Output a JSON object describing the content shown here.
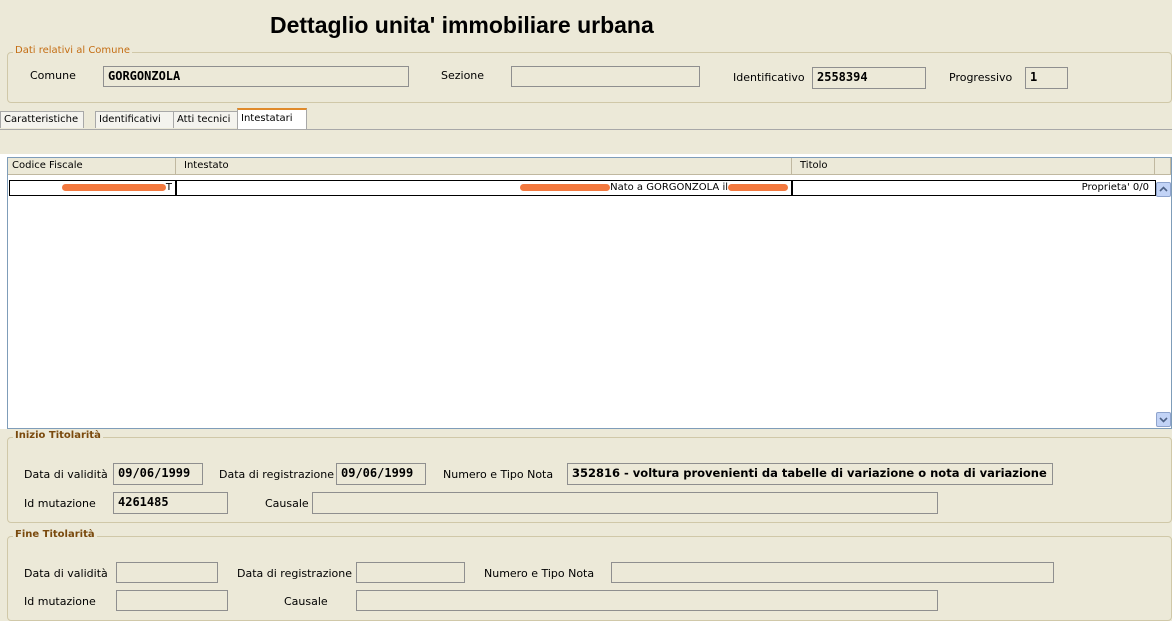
{
  "window_title": "Dettaglio unita' immobiliare urbana",
  "comune_group": {
    "legend": "Dati relativi al Comune",
    "comune_label": "Comune",
    "comune_value": "GORGONZOLA",
    "sezione_label": "Sezione",
    "sezione_value": "",
    "identificativo_label": "Identificativo",
    "identificativo_value": "2558394",
    "progressivo_label": "Progressivo",
    "progressivo_value": "1"
  },
  "tabs": [
    {
      "label": "Caratteristiche"
    },
    {
      "label": "Identificativi"
    },
    {
      "label": "Atti tecnici"
    },
    {
      "label": "Intestatari",
      "active": true
    }
  ],
  "table": {
    "headers": [
      "Codice Fiscale",
      "Intestato",
      "Titolo"
    ],
    "rows": [
      {
        "codice_fiscale": "T",
        "intestato": "Nato a GORGONZOLA il",
        "titolo": "Proprieta' 0/0"
      }
    ]
  },
  "inizio": {
    "legend": "Inizio Titolarità",
    "data_validita_label": "Data di validità",
    "data_validita_value": "09/06/1999",
    "data_registrazione_label": "Data di registrazione",
    "data_registrazione_value": "09/06/1999",
    "numero_nota_label": "Numero e Tipo Nota",
    "numero_nota_value": "352816 - voltura provenienti da tabelle di variazione o nota di variazione",
    "id_mutazione_label": "Id mutazione",
    "id_mutazione_value": "4261485",
    "causale_label": "Causale",
    "causale_value": ""
  },
  "fine": {
    "legend": "Fine Titolarità",
    "data_validita_label": "Data di validità",
    "data_validita_value": "",
    "data_registrazione_label": "Data di registrazione",
    "data_registrazione_value": "",
    "numero_nota_label": "Numero e Tipo Nota",
    "numero_nota_value": "",
    "id_mutazione_label": "Id mutazione",
    "id_mutazione_value": "",
    "causale_label": "Causale",
    "causale_value": ""
  },
  "colors": {
    "panel": "#ece9d8",
    "legend": "#c46e14",
    "active_tab_accent": "#e08a2a",
    "redaction": "#f26a2a"
  }
}
